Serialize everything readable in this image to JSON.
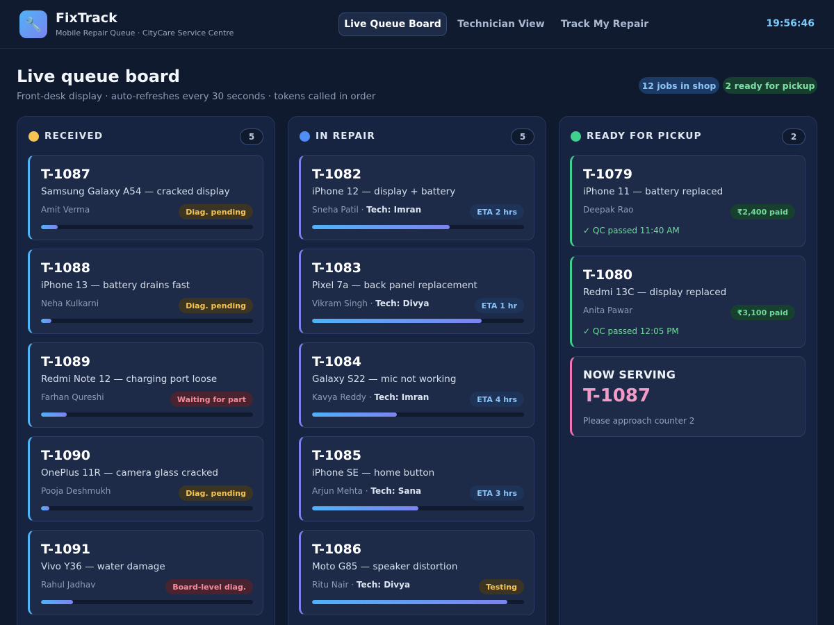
{
  "app": {
    "logo_icon": "wrench-icon",
    "title": "FixTrack",
    "subtitle": "Mobile Repair Queue · CityCare Service Centre"
  },
  "nav": {
    "tabs": [
      "Live Queue Board",
      "Technician View",
      "Track My Repair"
    ],
    "active": "Live Queue Board"
  },
  "clock": "19:56:46",
  "page": {
    "title": "Live queue board",
    "subtitle": "Front-desk display · auto-refreshes every 30 seconds · tokens called in order",
    "pill_jobs": "12 jobs in shop",
    "pill_ready": "2 ready for pickup"
  },
  "colors": {
    "received": "#f6c453",
    "in_repair": "#4f8ef6",
    "ready": "#3fcf8e",
    "accent": "#4fb3f6",
    "serving": "#f472b6"
  },
  "columns": {
    "received": {
      "title": "RECEIVED",
      "count": "5",
      "cards": [
        {
          "token": "T-1087",
          "device": "Samsung Galaxy A54 — cracked display",
          "customer": "Amit Verma",
          "status": "Diag. pending",
          "progress": 0.08
        },
        {
          "token": "T-1088",
          "device": "iPhone 13 — battery drains fast",
          "customer": "Neha Kulkarni",
          "status": "Diag. pending",
          "progress": 0.05
        },
        {
          "token": "T-1089",
          "device": "Redmi Note 12 — charging port loose",
          "customer": "Farhan Qureshi",
          "status": "Waiting for part",
          "progress": 0.12
        },
        {
          "token": "T-1090",
          "device": "OnePlus 11R — camera glass cracked",
          "customer": "Pooja Deshmukh",
          "status": "Diag. pending",
          "progress": 0.04
        },
        {
          "token": "T-1091",
          "device": "Vivo Y36 — water damage",
          "customer": "Rahul Jadhav",
          "status": "Board-level diag.",
          "progress": 0.15
        }
      ]
    },
    "in_repair": {
      "title": "IN REPAIR",
      "count": "5",
      "cards": [
        {
          "token": "T-1082",
          "device": "iPhone 12 — display + battery",
          "customer": "Sneha Patil",
          "tech": "Tech: Imran",
          "status": "ETA 2 hrs",
          "progress": 0.65
        },
        {
          "token": "T-1083",
          "device": "Pixel 7a — back panel replacement",
          "customer": "Vikram Singh",
          "tech": "Tech: Divya",
          "status": "ETA 1 hr",
          "progress": 0.8
        },
        {
          "token": "T-1084",
          "device": "Galaxy S22 — mic not working",
          "customer": "Kavya Reddy",
          "tech": "Tech: Imran",
          "status": "ETA 4 hrs",
          "progress": 0.4
        },
        {
          "token": "T-1085",
          "device": "iPhone SE — home button",
          "customer": "Arjun Mehta",
          "tech": "Tech: Sana",
          "status": "ETA 3 hrs",
          "progress": 0.5
        },
        {
          "token": "T-1086",
          "device": "Moto G85 — speaker distortion",
          "customer": "Ritu Nair",
          "tech": "Tech: Divya",
          "status": "Testing",
          "progress": 0.92
        }
      ]
    },
    "ready": {
      "title": "READY FOR PICKUP",
      "count": "2",
      "cards": [
        {
          "token": "T-1079",
          "device": "iPhone 11 — battery replaced",
          "customer": "Deepak Rao",
          "status": "₹2,400 paid",
          "qc": "✓ QC passed 11:40 AM"
        },
        {
          "token": "T-1080",
          "device": "Redmi 13C — display replaced",
          "customer": "Anita Pawar",
          "status": "₹3,100 paid",
          "qc": "✓ QC passed 12:05 PM"
        }
      ]
    }
  },
  "now_serving": {
    "label": "NOW SERVING",
    "token": "T-1087",
    "message": "Please approach counter 2"
  }
}
